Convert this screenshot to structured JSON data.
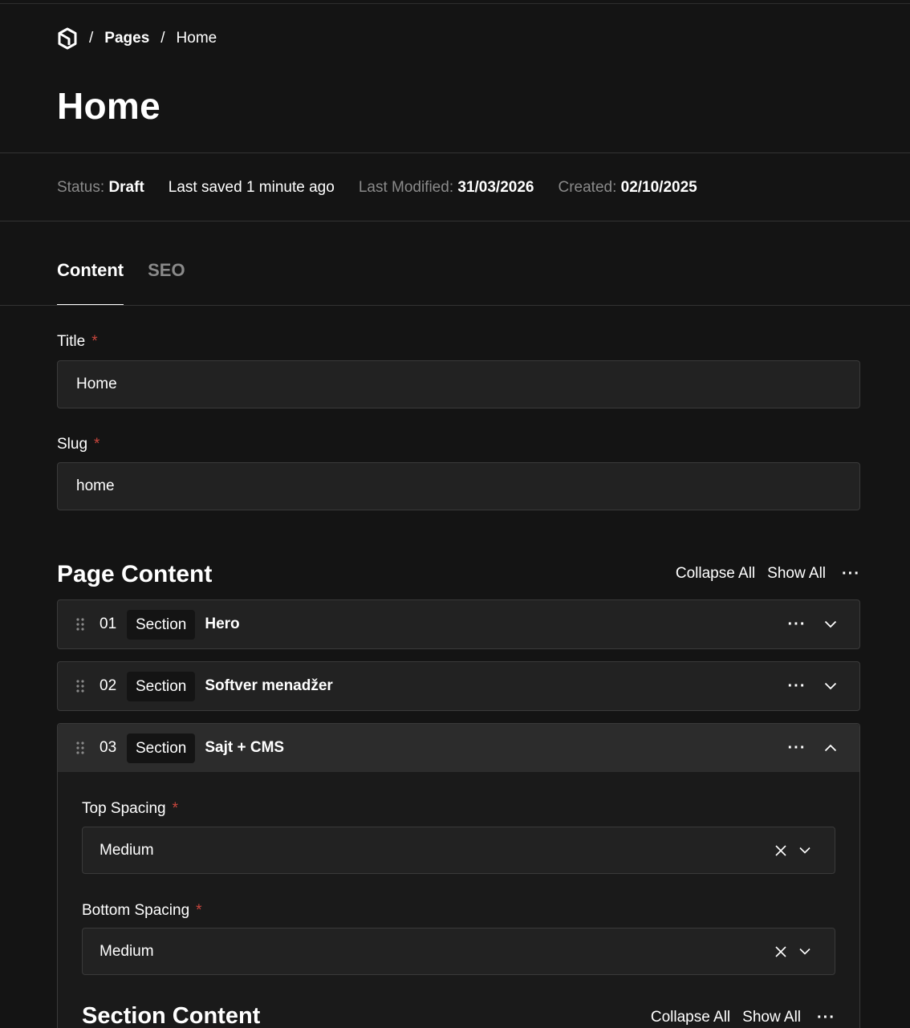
{
  "breadcrumb": {
    "logo_icon": "logo-icon",
    "separator": "/",
    "items": [
      {
        "label": "Pages"
      },
      {
        "label": "Home"
      }
    ]
  },
  "page": {
    "title": "Home"
  },
  "status": {
    "status_label": "Status:",
    "status_value": "Draft",
    "last_saved": "Last saved 1 minute ago",
    "modified_label": "Last Modified:",
    "modified_value": "31/03/2026",
    "created_label": "Created:",
    "created_value": "02/10/2025"
  },
  "tabs": [
    {
      "label": "Content",
      "active": true
    },
    {
      "label": "SEO",
      "active": false
    }
  ],
  "fields": {
    "title": {
      "label": "Title",
      "required": "*",
      "value": "Home"
    },
    "slug": {
      "label": "Slug",
      "required": "*",
      "value": "home"
    }
  },
  "page_content": {
    "heading": "Page Content",
    "collapse_all": "Collapse All",
    "show_all": "Show All",
    "more": "···",
    "blocks": [
      {
        "number": "01",
        "type": "Section",
        "title": "Hero",
        "expanded": false
      },
      {
        "number": "02",
        "type": "Section",
        "title": "Softver menadžer",
        "expanded": false
      },
      {
        "number": "03",
        "type": "Section",
        "title": "Sajt + CMS",
        "expanded": true
      }
    ]
  },
  "expanded_block": {
    "top_spacing": {
      "label": "Top Spacing",
      "required": "*",
      "value": "Medium"
    },
    "bottom_spacing": {
      "label": "Bottom Spacing",
      "required": "*",
      "value": "Medium"
    },
    "section_content": {
      "heading": "Section Content",
      "collapse_all": "Collapse All",
      "show_all": "Show All",
      "more": "···"
    }
  },
  "colors": {
    "background": "#141414",
    "surface": "#222222",
    "border": "#3a3a3a",
    "required": "#c9463d",
    "muted_text": "#8a8a8a"
  }
}
